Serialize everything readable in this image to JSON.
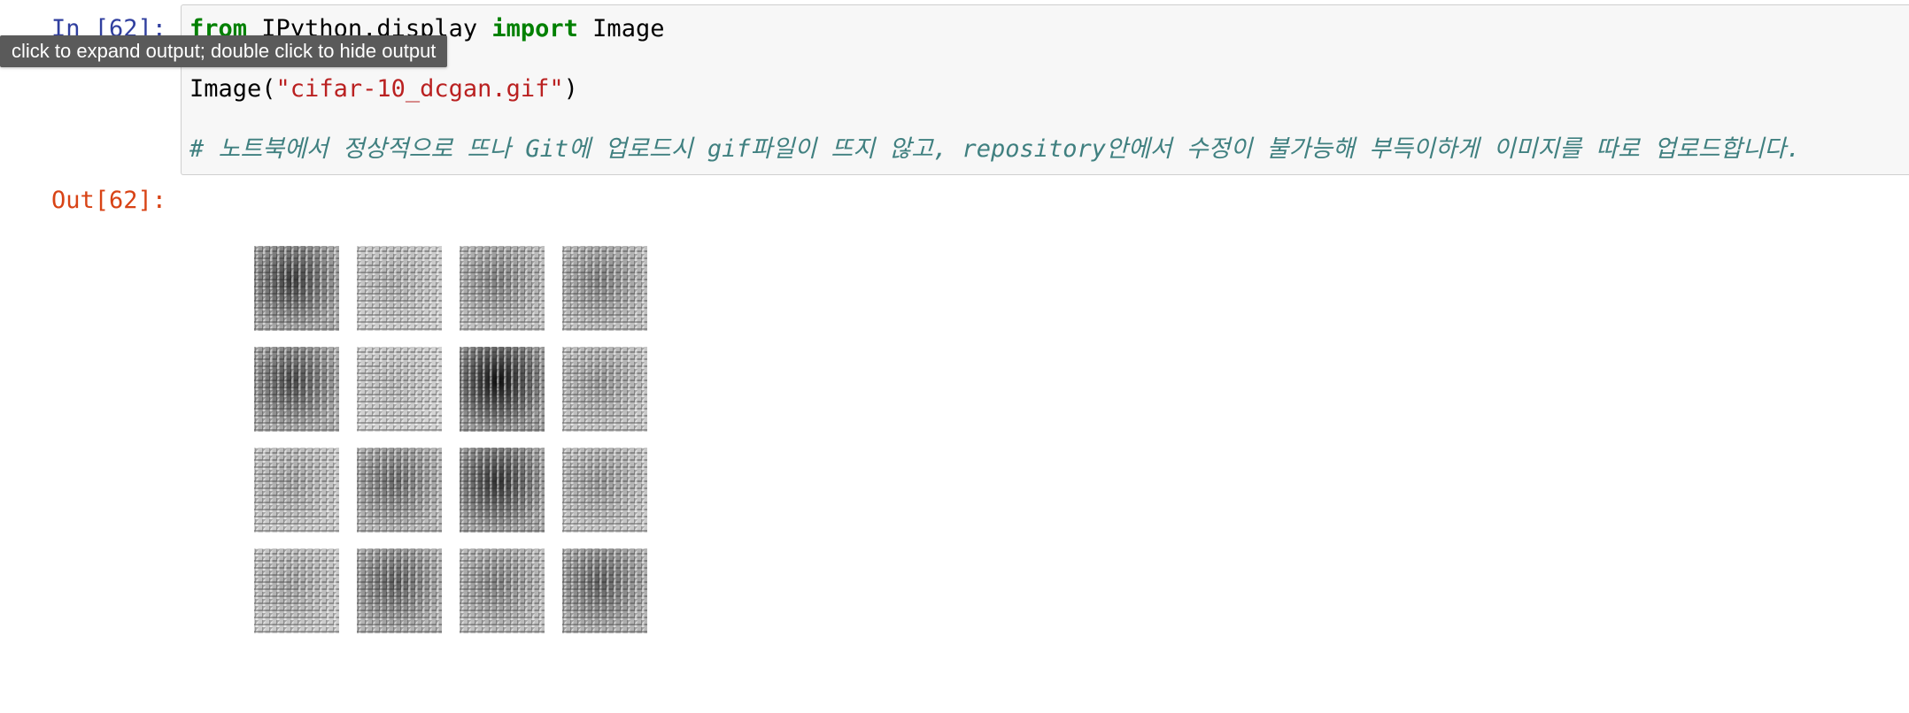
{
  "cell": {
    "in_prompt": "In [62]:",
    "out_prompt": "Out[62]:",
    "tooltip": "click to expand output; double click to hide output",
    "code": {
      "line1": {
        "kw_from": "from",
        "module": " IPython.display ",
        "kw_import": "import",
        "name": " Image"
      },
      "line2": {
        "func": "Image(",
        "arg": "\"cifar-10_dcgan.gif\"",
        "close": ")"
      },
      "line3": {
        "comment": "# 노트북에서 정상적으로 뜨나 Git에 업로드시 gif파일이 뜨지 않고, repository안에서 수정이 불가능해 부득이하게 이미지를 따로 업로드합니다."
      }
    }
  },
  "output": {
    "grid": {
      "rows": 4,
      "cols": 4,
      "tiles": [
        {
          "dark": 0.75
        },
        {
          "dark": 0.25
        },
        {
          "dark": 0.45
        },
        {
          "dark": 0.45
        },
        {
          "dark": 0.7
        },
        {
          "dark": 0.2
        },
        {
          "dark": 0.95
        },
        {
          "dark": 0.35
        },
        {
          "dark": 0.3
        },
        {
          "dark": 0.55
        },
        {
          "dark": 0.8
        },
        {
          "dark": 0.35
        },
        {
          "dark": 0.3
        },
        {
          "dark": 0.6
        },
        {
          "dark": 0.45
        },
        {
          "dark": 0.6
        }
      ]
    }
  },
  "colors": {
    "in_prompt": "#303f9f",
    "out_prompt": "#d84315",
    "keyword": "#008000",
    "string": "#ba2121",
    "comment": "#408080",
    "input_bg": "#f7f7f7",
    "tooltip_bg": "#5a5a5a"
  }
}
